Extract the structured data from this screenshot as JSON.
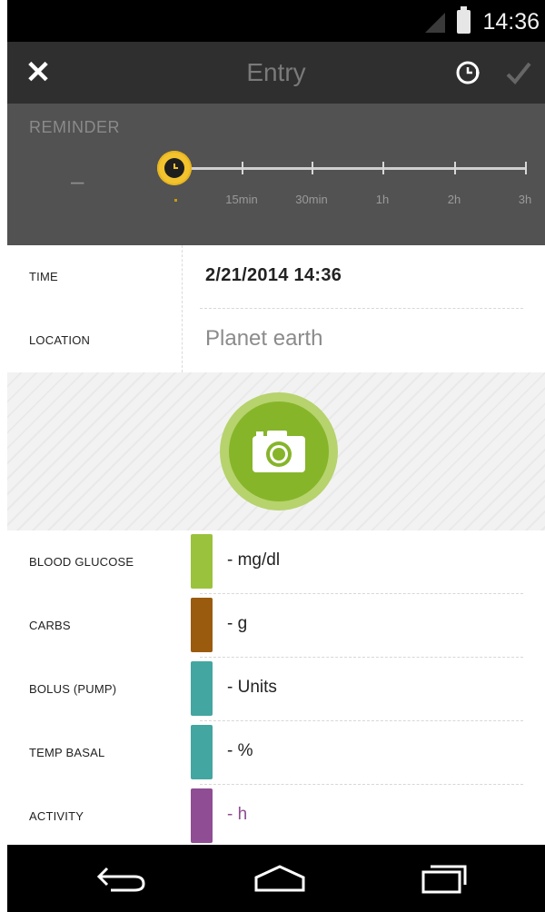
{
  "status_bar": {
    "time": "14:36"
  },
  "action_bar": {
    "title": "Entry",
    "close_icon": "close-icon",
    "reminder_icon": "clock-icon",
    "confirm_icon": "check-icon"
  },
  "reminder": {
    "label": "REMINDER",
    "off_label": "–",
    "ticks": [
      "15min",
      "30min",
      "1h",
      "2h",
      "3h"
    ],
    "accent_color": "#f2c32e"
  },
  "form": {
    "time_label": "TIME",
    "time_value": "2/21/2014    14:36",
    "location_label": "LOCATION",
    "location_value": "Planet earth"
  },
  "photo": {
    "icon": "camera-icon",
    "accent_color": "#86b52a"
  },
  "entries": [
    {
      "label": "BLOOD GLUCOSE",
      "value": "-  mg/dl",
      "color": "#9bc23c"
    },
    {
      "label": "CARBS",
      "value": "-  g",
      "color": "#9a5b0f"
    },
    {
      "label": "BOLUS (PUMP)",
      "value": "-  Units",
      "color": "#43a6a0"
    },
    {
      "label": "TEMP BASAL",
      "value": "-  %",
      "color": "#43a6a0"
    },
    {
      "label": "ACTIVITY",
      "value": "-  h",
      "color": "#8f4d93"
    }
  ],
  "nav": {
    "back_icon": "back-icon",
    "home_icon": "home-icon",
    "recents_icon": "recents-icon"
  }
}
